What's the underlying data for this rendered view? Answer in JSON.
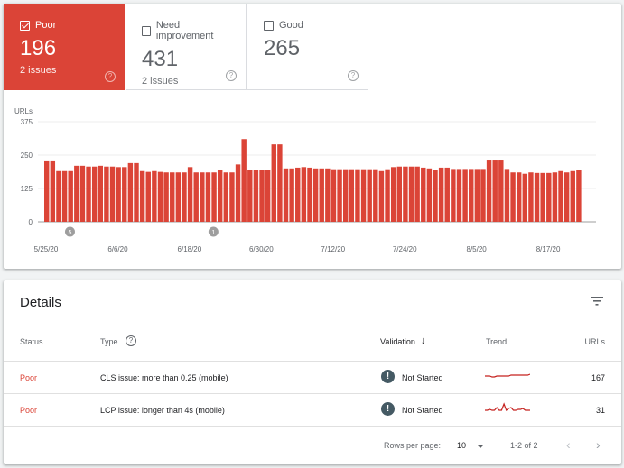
{
  "tiles": [
    {
      "label": "Poor",
      "value": "196",
      "issues": "2 issues",
      "checked": true
    },
    {
      "label": "Need improvement",
      "value": "431",
      "issues": "2 issues",
      "checked": false
    },
    {
      "label": "Good",
      "value": "265",
      "issues": "",
      "checked": false
    }
  ],
  "colors": {
    "poor": "#db4437",
    "text": "#202124",
    "muted": "#5f6368"
  },
  "chart_data": {
    "type": "bar",
    "ylabel": "URLs",
    "ylim": [
      0,
      375
    ],
    "yticks": [
      0,
      125,
      250,
      375
    ],
    "xtick_labels": [
      "5/25/20",
      "6/6/20",
      "6/18/20",
      "6/30/20",
      "7/12/20",
      "7/24/20",
      "8/5/20",
      "8/17/20"
    ],
    "start_date": "5/25/20",
    "values": [
      230,
      230,
      190,
      190,
      190,
      210,
      210,
      207,
      207,
      210,
      207,
      207,
      205,
      205,
      220,
      220,
      190,
      187,
      190,
      187,
      185,
      185,
      185,
      185,
      205,
      185,
      185,
      185,
      185,
      195,
      185,
      185,
      215,
      310,
      195,
      195,
      195,
      195,
      290,
      290,
      200,
      200,
      203,
      205,
      203,
      200,
      200,
      200,
      197,
      197,
      197,
      197,
      197,
      197,
      197,
      197,
      190,
      197,
      205,
      207,
      207,
      207,
      207,
      203,
      200,
      195,
      203,
      203,
      198,
      198,
      198,
      198,
      198,
      198,
      233,
      233,
      233,
      198,
      185,
      185,
      180,
      185,
      183,
      183,
      183,
      185,
      190,
      185,
      190,
      195
    ],
    "annotations": [
      {
        "label": "5",
        "date": "5/29/20"
      },
      {
        "label": "1",
        "date": "6/22/20"
      }
    ],
    "grid": true
  },
  "details": {
    "title": "Details",
    "headers": {
      "status": "Status",
      "type": "Type",
      "validation": "Validation",
      "trend": "Trend",
      "urls": "URLs"
    },
    "rows": [
      {
        "status": "Poor",
        "type": "CLS issue: more than 0.25 (mobile)",
        "validation": "Not Started",
        "urls": "167",
        "trend": [
          4,
          4,
          4,
          3,
          3,
          4,
          4,
          4,
          4,
          4,
          4,
          5,
          5,
          5,
          5,
          5,
          5,
          5,
          5,
          6
        ]
      },
      {
        "status": "Poor",
        "type": "LCP issue: longer than 4s (mobile)",
        "validation": "Not Started",
        "urls": "31",
        "trend": [
          2,
          2,
          3,
          2,
          2,
          5,
          2,
          2,
          9,
          2,
          4,
          5,
          2,
          2,
          3,
          3,
          4,
          2,
          2,
          2
        ]
      }
    ],
    "footer": {
      "rows_per_page_label": "Rows per page:",
      "rows_per_page": "10",
      "range": "1-2 of 2"
    }
  }
}
